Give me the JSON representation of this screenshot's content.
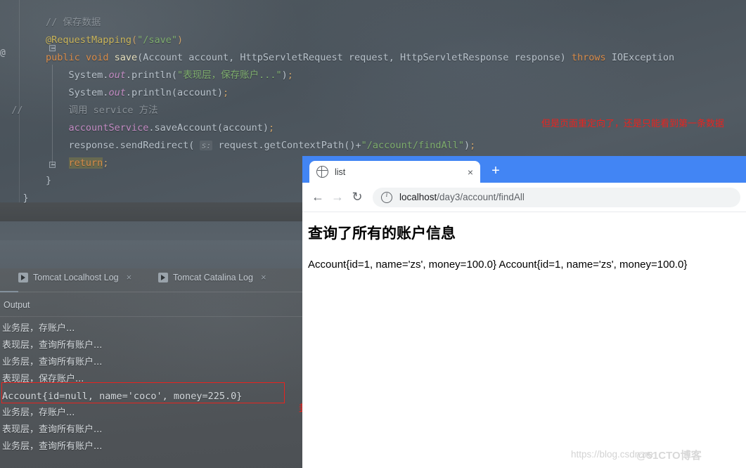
{
  "ide": {
    "code_lines": [
      [
        {
          "t": "        ",
          "c": "id"
        },
        {
          "t": "// 保存数据",
          "c": "cmt"
        }
      ],
      [
        {
          "t": "        ",
          "c": "id"
        },
        {
          "t": "@RequestMapping",
          "c": "ann"
        },
        {
          "t": "(",
          "c": "punc"
        },
        {
          "t": "\"/save\"",
          "c": "str"
        },
        {
          "t": ")",
          "c": "punc"
        }
      ],
      [
        {
          "t": "        ",
          "c": "id"
        },
        {
          "t": "public",
          "c": "kw"
        },
        {
          "t": " ",
          "c": "id"
        },
        {
          "t": "void",
          "c": "kw"
        },
        {
          "t": " ",
          "c": "id"
        },
        {
          "t": "save",
          "c": "fn"
        },
        {
          "t": "(Account account, HttpServletRequest request, HttpServletResponse response) ",
          "c": "id"
        },
        {
          "t": "throws",
          "c": "kw"
        },
        {
          "t": " IOException",
          "c": "id"
        }
      ],
      [
        {
          "t": "            System.",
          "c": "id"
        },
        {
          "t": "out",
          "c": "it"
        },
        {
          "t": ".println(",
          "c": "id"
        },
        {
          "t": "\"表现层，保存账户...\"",
          "c": "str"
        },
        {
          "t": ")",
          "c": "id"
        },
        {
          "t": ";",
          "c": "punc"
        }
      ],
      [
        {
          "t": "            System.",
          "c": "id"
        },
        {
          "t": "out",
          "c": "it"
        },
        {
          "t": ".println(account)",
          "c": "id"
        },
        {
          "t": ";",
          "c": "punc"
        }
      ],
      [
        {
          "t": "  //        调用 service 方法",
          "c": "cmt"
        }
      ],
      [
        {
          "t": "            ",
          "c": "id"
        },
        {
          "t": "accountService",
          "c": "fld"
        },
        {
          "t": ".saveAccount(account)",
          "c": "id"
        },
        {
          "t": ";",
          "c": "punc"
        }
      ],
      [
        {
          "t": "            response.sendRedirect( ",
          "c": "id"
        },
        {
          "t": "s:",
          "c": "hint"
        },
        {
          "t": " request.getContextPath()+",
          "c": "id"
        },
        {
          "t": "\"/account/findAll\"",
          "c": "str"
        },
        {
          "t": ")",
          "c": "id"
        },
        {
          "t": ";",
          "c": "punc"
        }
      ],
      [
        {
          "t": "            ",
          "c": "id"
        },
        {
          "t": "return",
          "c": "hl-return"
        },
        {
          "t": ";",
          "c": "punc"
        }
      ],
      [
        {
          "t": "        }",
          "c": "id"
        }
      ],
      [
        {
          "t": "    }",
          "c": "id"
        }
      ]
    ],
    "annotation_top": "但是页面重定向了，还是只能看到第一条数据",
    "annotation_bottom": "封装的数据在这里可以看到",
    "annotation_color": "#e8231f",
    "tool_tabs": [
      {
        "label": "Tomcat Localhost Log",
        "close": "×"
      },
      {
        "label": "Tomcat Catalina Log",
        "close": "×"
      }
    ],
    "output_label": "Output",
    "console_lines": [
      {
        "text": "业务层，存账户...",
        "cjk": true
      },
      {
        "text": "表现层，查询所有账户...",
        "cjk": true
      },
      {
        "text": "业务层，查询所有账户...",
        "cjk": true
      },
      {
        "text": "表现层，保存账户...",
        "cjk": true
      },
      {
        "text": "Account{id=null, name='coco', money=225.0}",
        "cjk": false
      },
      {
        "text": "业务层，存账户...",
        "cjk": true
      },
      {
        "text": "表现层，查询所有账户...",
        "cjk": true
      },
      {
        "text": "业务层，查询所有账户...",
        "cjk": true
      }
    ]
  },
  "browser": {
    "tab": {
      "title": "list",
      "close_label": "×",
      "favicon": "globe-icon"
    },
    "new_tab_label": "+",
    "nav": {
      "back": "←",
      "forward": "→",
      "reload": "↻"
    },
    "url": {
      "host": "localhost",
      "path": "/day3/account/findAll",
      "full": "localhost/day3/account/findAll"
    },
    "page": {
      "heading": "查询了所有的账户信息",
      "body": "Account{id=1, name='zs', money=100.0} Account{id=1, name='zs', money=100.0}"
    },
    "accent_color": "#4285f4"
  },
  "watermark": {
    "url": "https://blog.csdn.ne",
    "brand": "@51CTO博客"
  }
}
